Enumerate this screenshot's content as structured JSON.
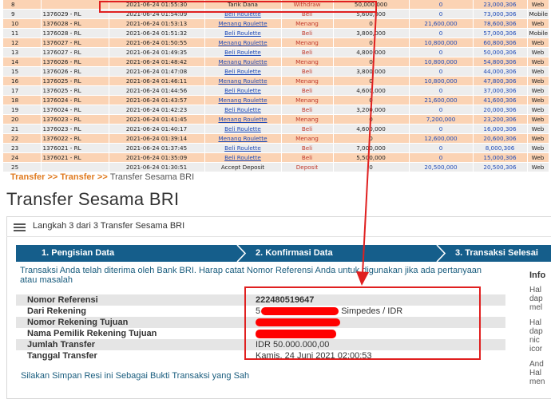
{
  "transactions": [
    {
      "no": "8",
      "id": "",
      "date": "2021-06-24 01:55:30",
      "desc": "Tarik Dana",
      "link": false,
      "type": "Withdraw",
      "amount": "50,000,000",
      "win": "0",
      "balance": "23,000,306",
      "device": "Web"
    },
    {
      "no": "9",
      "id": "1376029 - RL",
      "date": "2021-06-24 01:54:09",
      "desc": "Beli Roulette",
      "link": true,
      "type": "Beli",
      "amount": "5,600,000",
      "win": "0",
      "balance": "73,000,306",
      "device": "Mobile"
    },
    {
      "no": "10",
      "id": "1376028 - RL",
      "date": "2021-06-24 01:53:13",
      "desc": "Menang Roulette",
      "link": true,
      "type": "Menang",
      "amount": "0",
      "win": "21,600,000",
      "balance": "78,600,306",
      "device": "Web"
    },
    {
      "no": "11",
      "id": "1376028 - RL",
      "date": "2021-06-24 01:51:32",
      "desc": "Beli Roulette",
      "link": true,
      "type": "Beli",
      "amount": "3,800,000",
      "win": "0",
      "balance": "57,000,306",
      "device": "Mobile"
    },
    {
      "no": "12",
      "id": "1376027 - RL",
      "date": "2021-06-24 01:50:55",
      "desc": "Menang Roulette",
      "link": true,
      "type": "Menang",
      "amount": "0",
      "win": "10,800,000",
      "balance": "60,800,306",
      "device": "Web"
    },
    {
      "no": "13",
      "id": "1376027 - RL",
      "date": "2021-06-24 01:49:35",
      "desc": "Beli Roulette",
      "link": true,
      "type": "Beli",
      "amount": "4,800,000",
      "win": "0",
      "balance": "50,000,306",
      "device": "Web"
    },
    {
      "no": "14",
      "id": "1376026 - RL",
      "date": "2021-06-24 01:48:42",
      "desc": "Menang Roulette",
      "link": true,
      "type": "Menang",
      "amount": "0",
      "win": "10,800,000",
      "balance": "54,800,306",
      "device": "Web"
    },
    {
      "no": "15",
      "id": "1376026 - RL",
      "date": "2021-06-24 01:47:08",
      "desc": "Beli Roulette",
      "link": true,
      "type": "Beli",
      "amount": "3,800,000",
      "win": "0",
      "balance": "44,000,306",
      "device": "Web"
    },
    {
      "no": "16",
      "id": "1376025 - RL",
      "date": "2021-06-24 01:46:11",
      "desc": "Menang Roulette",
      "link": true,
      "type": "Menang",
      "amount": "0",
      "win": "10,800,000",
      "balance": "47,800,306",
      "device": "Web"
    },
    {
      "no": "17",
      "id": "1376025 - RL",
      "date": "2021-06-24 01:44:56",
      "desc": "Beli Roulette",
      "link": true,
      "type": "Beli",
      "amount": "4,600,000",
      "win": "0",
      "balance": "37,000,306",
      "device": "Web"
    },
    {
      "no": "18",
      "id": "1376024 - RL",
      "date": "2021-06-24 01:43:57",
      "desc": "Menang Roulette",
      "link": true,
      "type": "Menang",
      "amount": "0",
      "win": "21,600,000",
      "balance": "41,600,306",
      "device": "Web"
    },
    {
      "no": "19",
      "id": "1376024 - RL",
      "date": "2021-06-24 01:42:23",
      "desc": "Beli Roulette",
      "link": true,
      "type": "Beli",
      "amount": "3,200,000",
      "win": "0",
      "balance": "20,000,306",
      "device": "Web"
    },
    {
      "no": "20",
      "id": "1376023 - RL",
      "date": "2021-06-24 01:41:45",
      "desc": "Menang Roulette",
      "link": true,
      "type": "Menang",
      "amount": "0",
      "win": "7,200,000",
      "balance": "23,200,306",
      "device": "Web"
    },
    {
      "no": "21",
      "id": "1376023 - RL",
      "date": "2021-06-24 01:40:17",
      "desc": "Beli Roulette",
      "link": true,
      "type": "Beli",
      "amount": "4,600,000",
      "win": "0",
      "balance": "16,000,306",
      "device": "Web"
    },
    {
      "no": "22",
      "id": "1376022 - RL",
      "date": "2021-06-24 01:39:14",
      "desc": "Menang Roulette",
      "link": true,
      "type": "Menang",
      "amount": "0",
      "win": "12,600,000",
      "balance": "20,600,306",
      "device": "Web"
    },
    {
      "no": "23",
      "id": "1376021 - RL",
      "date": "2021-06-24 01:37:45",
      "desc": "Beli Roulette",
      "link": true,
      "type": "Beli",
      "amount": "7,000,000",
      "win": "0",
      "balance": "8,000,306",
      "device": "Web"
    },
    {
      "no": "24",
      "id": "1376021 - RL",
      "date": "2021-06-24 01:35:09",
      "desc": "Beli Roulette",
      "link": true,
      "type": "Beli",
      "amount": "5,500,000",
      "win": "0",
      "balance": "15,000,306",
      "device": "Web"
    },
    {
      "no": "25",
      "id": "",
      "date": "2021-06-24 01:30:51",
      "desc": "Accept Deposit",
      "link": false,
      "type": "Deposit",
      "amount": "0",
      "win": "20,500,000",
      "balance": "20,500,306",
      "device": "Web"
    }
  ],
  "bri": {
    "breadcrumb": [
      "Transfer",
      ">>",
      "Transfer",
      ">>",
      "Transfer Sesama BRI"
    ],
    "title": "Transfer Sesama BRI",
    "steps_label": "Langkah 3 dari 3 Transfer Sesama BRI",
    "progress": [
      "1. Pengisian Data",
      "2. Konfirmasi Data",
      "3. Transaksi Selesai"
    ],
    "info": "Transaksi Anda telah diterima oleh Bank BRI. Harap catat Nomor Referensi Anda untuk digunakan jika ada pertanyaan atau masalah",
    "details": [
      {
        "label": "Nomor Referensi",
        "value": "222480519647"
      },
      {
        "label": "Dari Rekening",
        "value": "5",
        "suffix": "Simpedes / IDR"
      },
      {
        "label": "Nomor Rekening Tujuan",
        "value": ""
      },
      {
        "label": "Nama Pemilik Rekening Tujuan",
        "value": ""
      },
      {
        "label": "Jumlah Transfer",
        "value": "IDR 50.000.000,00"
      },
      {
        "label": "Tanggal Transfer",
        "value": "Kamis, 24 Juni 2021 02:00:53"
      }
    ],
    "resi": "Silakan Simpan Resi ini Sebagai Bukti Transaksi yang Sah",
    "side": {
      "title": "Info",
      "lines": [
        "Hal",
        "dap",
        "mel",
        "",
        "Hal",
        "dap",
        "nic",
        "icor",
        "",
        "And",
        "Hal",
        "men"
      ]
    }
  },
  "colors": {
    "annotation": "#e02020",
    "redaction": "#ff0000",
    "progress": "#155e8b",
    "breadcrumb": "#e07b20"
  }
}
